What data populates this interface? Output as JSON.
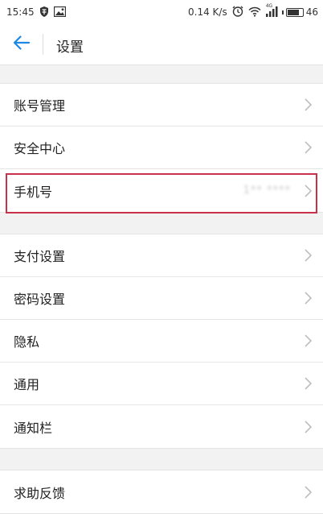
{
  "status_bar": {
    "time": "15:45",
    "speed": "0.14 K/s",
    "network": "4G",
    "battery": "46"
  },
  "header": {
    "title": "设置"
  },
  "groups": [
    {
      "items": [
        {
          "label": "账号管理",
          "value": ""
        },
        {
          "label": "安全中心",
          "value": ""
        },
        {
          "label": "手机号",
          "value": "1**  ****"
        }
      ]
    },
    {
      "items": [
        {
          "label": "支付设置",
          "value": ""
        },
        {
          "label": "密码设置",
          "value": ""
        },
        {
          "label": "隐私",
          "value": ""
        },
        {
          "label": "通用",
          "value": ""
        },
        {
          "label": "通知栏",
          "value": ""
        }
      ]
    },
    {
      "items": [
        {
          "label": "求助反馈",
          "value": ""
        }
      ]
    }
  ],
  "colors": {
    "accent": "#1e88e5",
    "highlight_border": "#c8314a",
    "background": "#f2f2f2"
  },
  "icons": {
    "back": "arrow-left-icon",
    "chevron": "chevron-right-icon"
  }
}
